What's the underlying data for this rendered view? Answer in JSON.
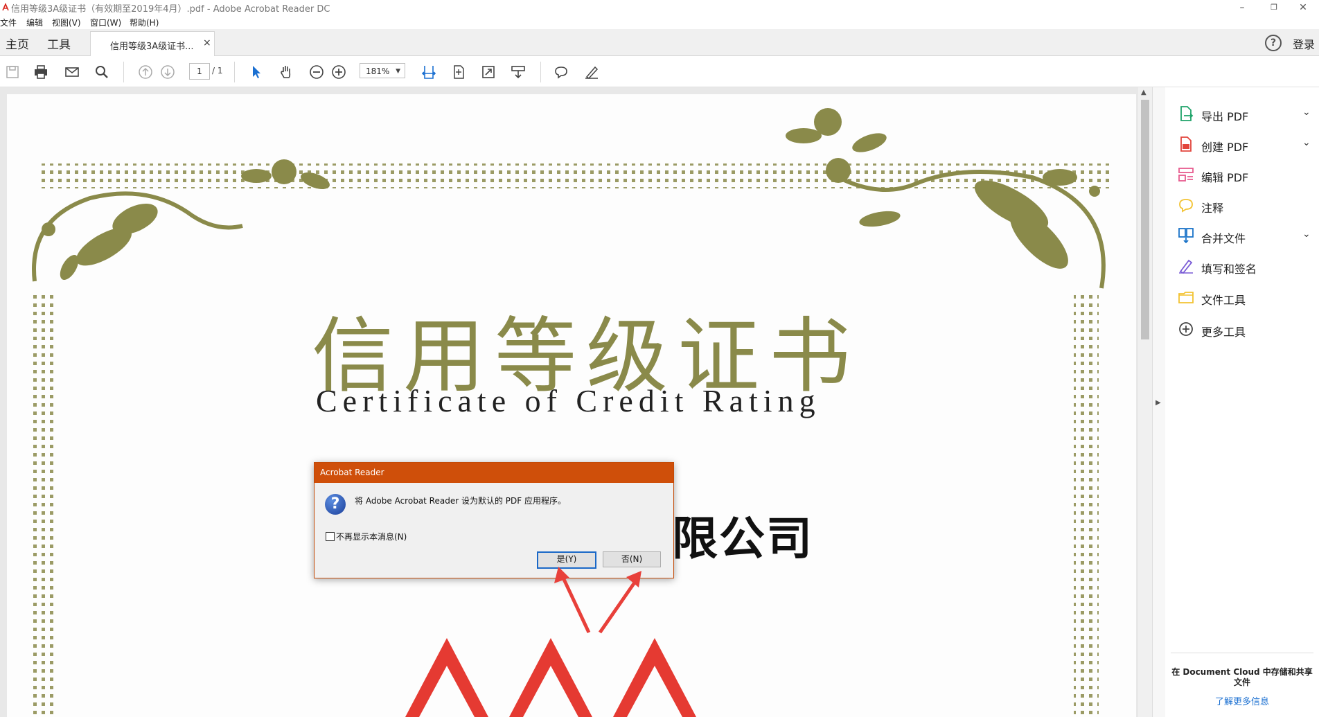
{
  "window": {
    "title": "信用等级3A级证书（有效期至2019年4月）.pdf - Adobe Acrobat Reader DC",
    "controls": [
      "–",
      "❐",
      "✕"
    ]
  },
  "menu": [
    "文件",
    "编辑",
    "视图(V)",
    "窗口(W)",
    "帮助(H)"
  ],
  "tabs": {
    "home": "主页",
    "tools": "工具",
    "document": "信用等级3A级证书...",
    "close": "×",
    "help": "?",
    "login": "登录"
  },
  "toolbar": {
    "page_current": "1",
    "page_total": "/ 1",
    "zoom": "181%",
    "icons": [
      "save-icon",
      "print-icon",
      "email-icon",
      "search-icon",
      "prev-page-icon",
      "next-page-icon",
      "select-icon",
      "hand-icon",
      "zoom-out-icon",
      "zoom-in-icon",
      "fit-width-icon",
      "fit-page-icon",
      "full-screen-icon",
      "scroll-mode-icon",
      "comment-icon",
      "sign-icon"
    ]
  },
  "document": {
    "title_cn": "信用等级证书",
    "title_en": "Certificate of Credit Rating",
    "company_fragment": "限公司"
  },
  "right_panel": {
    "tools": [
      {
        "label": "导出 PDF",
        "icon": "export-pdf-icon",
        "color": "#1fa36a",
        "has_chevron": true
      },
      {
        "label": "创建 PDF",
        "icon": "create-pdf-icon",
        "color": "#e2453c",
        "has_chevron": true
      },
      {
        "label": "编辑 PDF",
        "icon": "edit-pdf-icon",
        "color": "#e75b8e",
        "has_chevron": false
      },
      {
        "label": "注释",
        "icon": "comment-icon",
        "color": "#f2c230",
        "has_chevron": false
      },
      {
        "label": "合并文件",
        "icon": "combine-files-icon",
        "color": "#1a73c8",
        "has_chevron": true
      },
      {
        "label": "填写和签名",
        "icon": "fill-sign-icon",
        "color": "#7a5cd6",
        "has_chevron": false
      },
      {
        "label": "文件工具",
        "icon": "file-tools-icon",
        "color": "#f2c230",
        "has_chevron": false
      },
      {
        "label": "更多工具",
        "icon": "more-tools-icon",
        "color": "#444444",
        "has_chevron": false
      }
    ],
    "chevron": "⌄",
    "cloud_text": "在 Document Cloud 中存储和共享文件",
    "cloud_link": "了解更多信息"
  },
  "dialog": {
    "title": "Acrobat Reader",
    "message": "将 Adobe Acrobat Reader 设为默认的 PDF 应用程序。",
    "checkbox_label": "不再显示本消息(N)",
    "yes": "是(Y)",
    "no": "否(N)",
    "question_glyph": "?"
  },
  "colors": {
    "accent_orange": "#cf4f0a",
    "ornament_olive": "#8a8a4a",
    "annotation_red": "#e8403a",
    "logo_red": "#e53a32"
  }
}
